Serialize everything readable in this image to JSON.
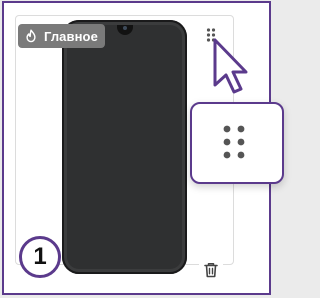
{
  "badge": {
    "label": "Главное",
    "icon": "fire-icon"
  },
  "step": {
    "number": "1"
  },
  "icons": {
    "drag_handle": "drag-handle-icon",
    "delete": "trash-icon",
    "cursor": "mouse-pointer-icon"
  },
  "colors": {
    "accent": "#5b3a8c",
    "badge_bg": "#7a7a7a",
    "phone": "#2f3031",
    "icon_dots": "#555555"
  }
}
